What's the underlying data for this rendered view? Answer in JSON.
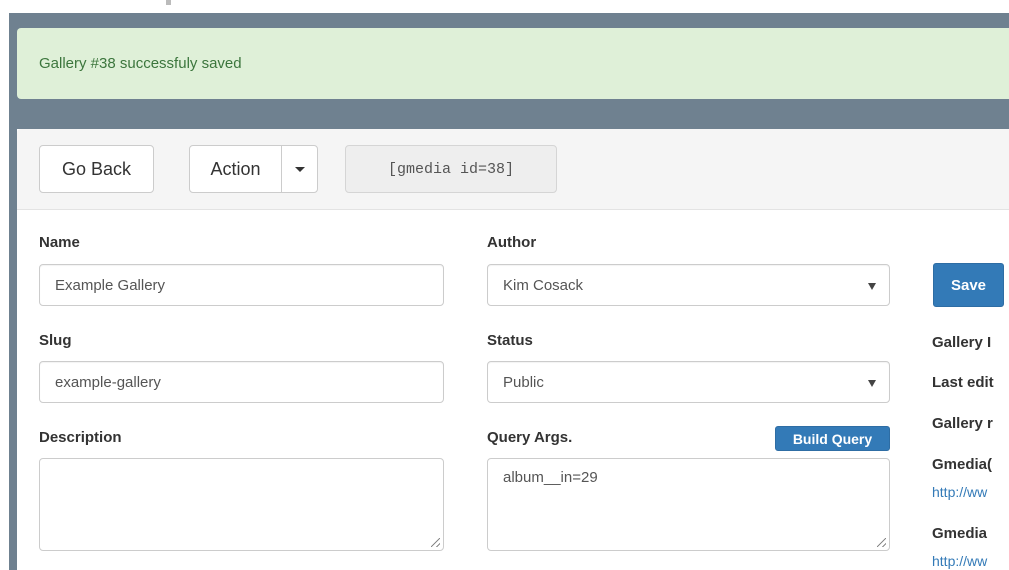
{
  "alert": {
    "message": "Gallery #38 successfuly saved"
  },
  "toolbar": {
    "go_back_label": "Go Back",
    "action_label": "Action",
    "shortcode": "[gmedia id=38]"
  },
  "form": {
    "name": {
      "label": "Name",
      "value": "Example Gallery"
    },
    "slug": {
      "label": "Slug",
      "value": "example-gallery"
    },
    "description": {
      "label": "Description",
      "value": ""
    },
    "author": {
      "label": "Author",
      "selected": "Kim Cosack"
    },
    "status": {
      "label": "Status",
      "selected": "Public"
    },
    "query_args": {
      "label": "Query Args.",
      "value": "album__in=29",
      "build_query_label": "Build Query"
    }
  },
  "sidebar": {
    "save_label": "Save",
    "gallery_id_label": "Gallery I",
    "last_edited_label": "Last edit",
    "gallery_module_label": "Gallery r",
    "gmedia_cloud_label": "Gmedia(",
    "gmedia_cloud_link": "http://ww",
    "gmedia_link_label": "Gmedia",
    "gmedia_link": "http://ww"
  },
  "colors": {
    "alert_bg": "#dff0d8",
    "alert_text": "#3c763d",
    "primary": "#337ab7",
    "frame_bg": "#6f8190"
  }
}
